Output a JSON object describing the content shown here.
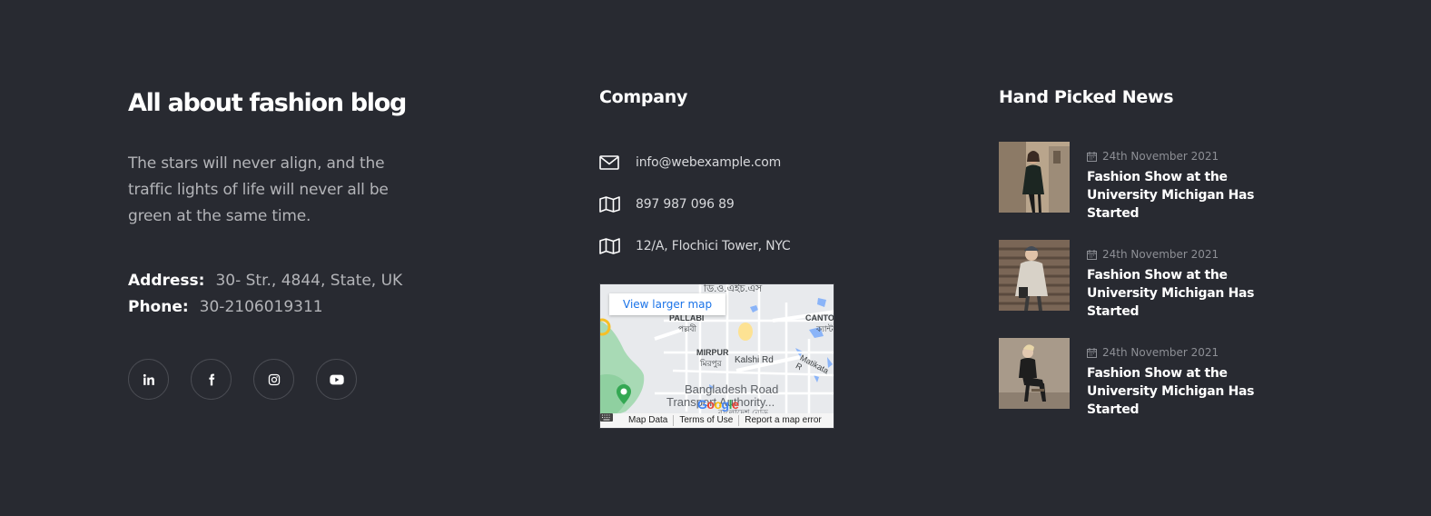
{
  "about": {
    "title": "All about fashion blog",
    "description": "The stars will never align, and the traffic lights of life will never all be green at the same time.",
    "address_label": "Address:",
    "address_value": "30- Str., 4844, State, UK",
    "phone_label": "Phone:",
    "phone_value": "30-2106019311",
    "socials": [
      "linkedin-icon",
      "facebook-icon",
      "instagram-icon",
      "youtube-icon"
    ]
  },
  "company": {
    "title": "Company",
    "items": [
      {
        "icon": "mail-icon",
        "text": "info@webexample.com"
      },
      {
        "icon": "map-icon",
        "text": "897 987 096 89"
      },
      {
        "icon": "map-icon",
        "text": "12/A, Flochici Tower, NYC"
      }
    ],
    "map": {
      "view_larger": "View larger map",
      "labels": {
        "pallabi_en": "PALLABI",
        "pallabi_bn": "পল্লবী",
        "mirpur_en": "MIRPUR",
        "mirpur_bn": "মিরপুর",
        "kalshi": "Kalshi Rd",
        "matikata": "Matikata R",
        "canto": "CANTO",
        "canto_bn": "ক্যান্ট",
        "top_bn": "ডি.ও.এইচ.এস",
        "brta1": "Bangladesh Road",
        "brta2": "Transport Authority...",
        "brta_bn": "বাংলাদেশ রোড"
      },
      "google": "Google",
      "footer": [
        "Map Data",
        "Terms of Use",
        "Report a map error"
      ]
    }
  },
  "news": {
    "title": "Hand Picked News",
    "items": [
      {
        "date": "24th November 2021",
        "title": "Fashion Show at the University Michigan Has Started"
      },
      {
        "date": "24th November 2021",
        "title": "Fashion Show at the University Michigan Has Started"
      },
      {
        "date": "24th November 2021",
        "title": "Fashion Show at the University Michigan Has Started"
      }
    ]
  },
  "colors": {
    "background": "#282a31",
    "muted_text": "#b3b4b8",
    "map_link": "#1a73e8"
  }
}
